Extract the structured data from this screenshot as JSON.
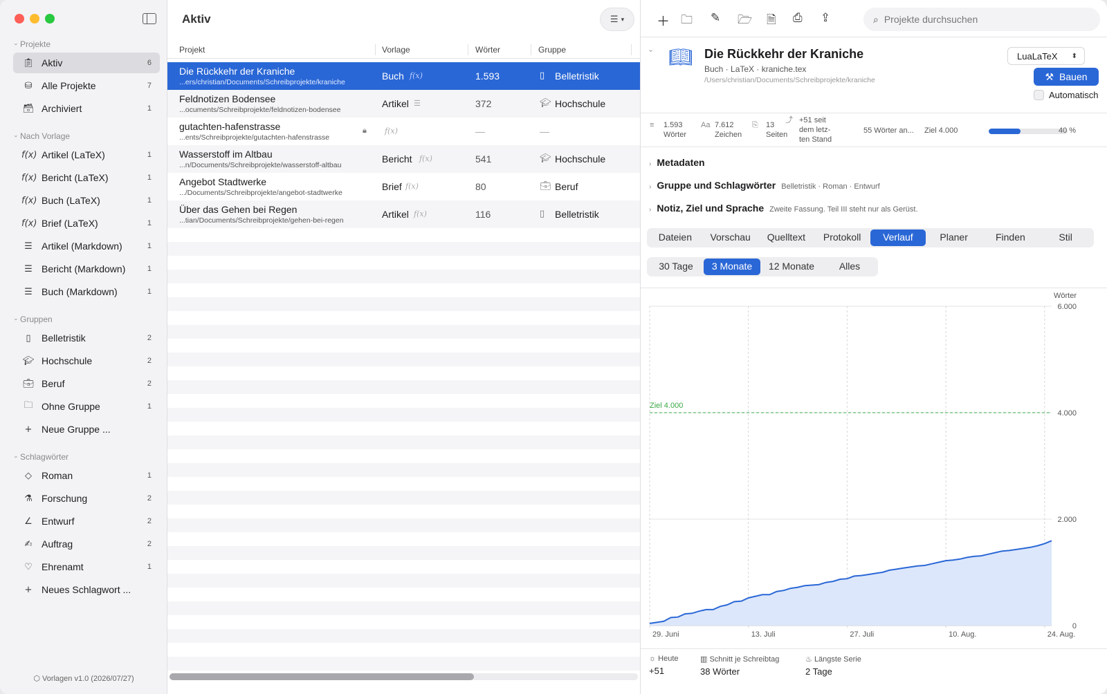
{
  "sidebar": {
    "sections": {
      "projekte": "Projekte",
      "vorlage": "Nach Vorlage",
      "gruppen": "Gruppen",
      "schlagwoerter": "Schlagwörter"
    },
    "projekte": [
      {
        "label": "Aktiv",
        "count": "6",
        "icon": "clipboard-icon"
      },
      {
        "label": "Alle Projekte",
        "count": "7",
        "icon": "stack-icon"
      },
      {
        "label": "Archiviert",
        "count": "1",
        "icon": "archive-box-icon"
      }
    ],
    "vorlagen": [
      {
        "label": "Artikel (LaTeX)",
        "count": "1"
      },
      {
        "label": "Bericht (LaTeX)",
        "count": "1"
      },
      {
        "label": "Buch (LaTeX)",
        "count": "1"
      },
      {
        "label": "Brief (LaTeX)",
        "count": "1"
      },
      {
        "label": "Artikel (Markdown)",
        "count": "1"
      },
      {
        "label": "Bericht (Markdown)",
        "count": "1"
      },
      {
        "label": "Buch (Markdown)",
        "count": "1"
      }
    ],
    "gruppen": [
      {
        "label": "Belletristik",
        "count": "2"
      },
      {
        "label": "Hochschule",
        "count": "2"
      },
      {
        "label": "Beruf",
        "count": "2"
      },
      {
        "label": "Ohne Gruppe",
        "count": "1"
      }
    ],
    "neue_gruppe": "Neue Gruppe ...",
    "schlagwoerter": [
      {
        "label": "Roman",
        "count": "1"
      },
      {
        "label": "Forschung",
        "count": "2"
      },
      {
        "label": "Entwurf",
        "count": "2"
      },
      {
        "label": "Auftrag",
        "count": "2"
      },
      {
        "label": "Ehrenamt",
        "count": "1"
      }
    ],
    "neues_schlagwort": "Neues Schlagwort ...",
    "footer": "Vorlagen v1.0 (2026/07/27)"
  },
  "list": {
    "title": "Aktiv",
    "columns": {
      "projekt": "Projekt",
      "vorlage": "Vorlage",
      "woerter": "Wörter",
      "gruppe": "Gruppe"
    },
    "rows": [
      {
        "name": "Die Rückkehr der Kraniche",
        "path": "...ers/christian/Documents/Schreibprojekte/kraniche",
        "template": "Buch",
        "words": "1.593",
        "group": "Belletristik"
      },
      {
        "name": "Feldnotizen Bodensee",
        "path": "...ocuments/Schreibprojekte/feldnotizen-bodensee",
        "template": "Artikel",
        "words": "372",
        "group": "Hochschule"
      },
      {
        "name": "gutachten-hafenstrasse",
        "path": "...ents/Schreibprojekte/gutachten-hafenstrasse",
        "template": "",
        "words": "—",
        "group": "—"
      },
      {
        "name": "Wasserstoff im Altbau",
        "path": "...n/Documents/Schreibprojekte/wasserstoff-altbau",
        "template": "Bericht",
        "words": "541",
        "group": "Hochschule"
      },
      {
        "name": "Angebot Stadtwerke",
        "path": ".../Documents/Schreibprojekte/angebot-stadtwerke",
        "template": "Brief",
        "words": "80",
        "group": "Beruf"
      },
      {
        "name": "Über das Gehen bei Regen",
        "path": "...tian/Documents/Schreibprojekte/gehen-bei-regen",
        "template": "Artikel",
        "words": "116",
        "group": "Belletristik"
      }
    ]
  },
  "detail": {
    "search_placeholder": "Projekte durchsuchen",
    "title": "Die Rückkehr der Kraniche",
    "subtitle": "Buch · LaTeX · kraniche.tex",
    "path": "/Users/christian/Documents/Schreibprojekte/kraniche",
    "engine": "LuaLaTeX",
    "build": "Bauen",
    "automatic": "Automatisch",
    "stats": {
      "words_val": "1.593",
      "words_lbl": "Wörter",
      "chars_val": "7.612",
      "chars_lbl": "Zeichen",
      "pages_val": "13",
      "pages_lbl": "Seiten",
      "delta_1": "+51 seit",
      "delta_2": "dem letz-",
      "delta_3": "ten Stand",
      "words_short": "55 Wörter an...",
      "goal": "Ziel 4.000",
      "progress_pct": "40 %",
      "progress_fraction": 0.4
    },
    "sections": [
      {
        "title": "Metadaten",
        "detail": ""
      },
      {
        "title": "Gruppe und Schlagwörter",
        "detail": "Belletristik · Roman · Entwurf"
      },
      {
        "title": "Notiz, Ziel und Sprache",
        "detail": "Zweite Fassung. Teil III steht nur als Gerüst."
      }
    ],
    "tabs": [
      "Dateien",
      "Vorschau",
      "Quelltext",
      "Protokoll",
      "Verlauf",
      "Planer",
      "Finden",
      "Stil"
    ],
    "active_tab": "Verlauf",
    "ranges": [
      "30 Tage",
      "3 Monate",
      "12 Monate",
      "Alles"
    ],
    "active_range": "3 Monate",
    "footer": {
      "today_lbl": "Heute",
      "today_val": "+51",
      "avg_lbl": "Schnitt je Schreibtag",
      "avg_val": "38 Wörter",
      "streak_lbl": "Längste Serie",
      "streak_val": "2 Tage"
    }
  },
  "chart_data": {
    "type": "area",
    "ylabel": "Wörter",
    "ylim": [
      0,
      6000
    ],
    "yticks": [
      "0",
      "2.000",
      "4.000",
      "6.000"
    ],
    "xticks": [
      "29. Juni",
      "13. Juli",
      "27. Juli",
      "10. Aug.",
      "24. Aug."
    ],
    "goal_value": 4000,
    "goal_label": "Ziel 4.000",
    "x_days": [
      0,
      2,
      4,
      6,
      8,
      10,
      12,
      14,
      16,
      18,
      20,
      22,
      24,
      26,
      28,
      30,
      32,
      34,
      36,
      38,
      40,
      42,
      44,
      46,
      48,
      50,
      52,
      54,
      56,
      58,
      60,
      62,
      64,
      66,
      68,
      70,
      72,
      74,
      76,
      78,
      80,
      82,
      84,
      86,
      88,
      90,
      92,
      94,
      96,
      98,
      100,
      102,
      104,
      106,
      108,
      110,
      112,
      114
    ],
    "values": [
      40,
      60,
      80,
      150,
      160,
      220,
      230,
      270,
      300,
      300,
      360,
      390,
      450,
      460,
      520,
      550,
      580,
      580,
      640,
      660,
      700,
      720,
      750,
      760,
      770,
      810,
      830,
      870,
      880,
      930,
      940,
      960,
      980,
      1000,
      1040,
      1060,
      1080,
      1100,
      1120,
      1130,
      1160,
      1190,
      1220,
      1230,
      1250,
      1280,
      1300,
      1310,
      1340,
      1370,
      1400,
      1410,
      1430,
      1450,
      1470,
      1500,
      1540,
      1593
    ],
    "color": "#2a67d6"
  }
}
